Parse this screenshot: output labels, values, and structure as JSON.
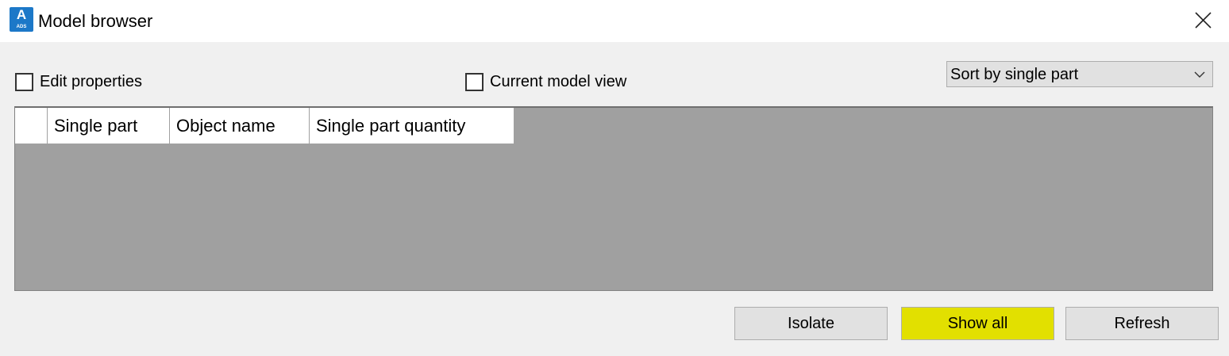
{
  "window": {
    "title": "Model browser",
    "app_icon": {
      "letter": "A",
      "sub": "ADS",
      "color": "#1c78c8",
      "icon": "autocad-ads-icon"
    },
    "close_icon": "close-icon"
  },
  "options": {
    "edit_properties": {
      "label": "Edit properties",
      "checked": false
    },
    "current_model_view": {
      "label": "Current model view",
      "checked": false
    },
    "sort": {
      "selected": "Sort by single part",
      "icon": "chevron-down-icon"
    }
  },
  "grid": {
    "columns": [
      "",
      "Single part",
      "Object name",
      "Single part quantity"
    ],
    "rows": []
  },
  "buttons": {
    "isolate": "Isolate",
    "show_all": "Show all",
    "refresh": "Refresh"
  },
  "colors": {
    "highlight": "#e2e000",
    "grid_background": "#a0a0a0",
    "dialog_background": "#f0f0f0"
  }
}
